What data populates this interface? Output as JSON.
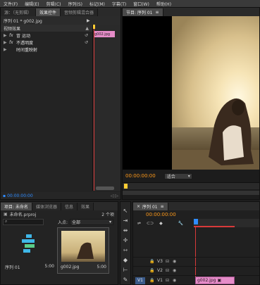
{
  "menubar": {
    "items": [
      "文件(F)",
      "编辑(E)",
      "剪辑(C)",
      "序列(S)",
      "标记(M)",
      "字幕(T)",
      "窗口(W)",
      "帮助(H)"
    ]
  },
  "source_panel": {
    "tabs": [
      "源：（无剪辑）",
      "效果控件",
      "音频剪辑混合器"
    ],
    "active_tab": 1,
    "header_title": "序列 01 * g002.jpg",
    "clip_label": "g002.jpg",
    "section_title": "视频效果",
    "effects": [
      {
        "icon": "fx",
        "label": "运动",
        "prefix": "冒"
      },
      {
        "icon": "fx",
        "label": "不透明度",
        "prefix": ""
      },
      {
        "icon": "",
        "label": "时间重映射",
        "prefix": ""
      }
    ],
    "timecode": "00:00:00:00"
  },
  "program_panel": {
    "tab": "节目: 序列 01",
    "timecode": "00:00:00:00",
    "fit_select": "适合"
  },
  "project_panel": {
    "tabs": [
      "项目: 未命名",
      "媒体浏览器",
      "信息",
      "效果"
    ],
    "project_file": "未命名.prproj",
    "item_count": "2 个项",
    "search_placeholder": "",
    "inlet_label": "入点:",
    "inlet_value": "全部",
    "items": [
      {
        "name": "序列 01",
        "duration": "5:00"
      },
      {
        "name": "g002.jpg",
        "duration": "5:00"
      }
    ]
  },
  "timeline_panel": {
    "tab": "序列 01",
    "timecode": "00:00:00:00",
    "tracks": [
      {
        "name": "V3"
      },
      {
        "name": "V2"
      },
      {
        "name": "V1",
        "source": "V1",
        "clip": "g002.jpg"
      }
    ]
  },
  "colors": {
    "timecode_blue": "#2f8cff",
    "timecode_orange": "#ff9a1a",
    "playhead_red": "#d83a3a",
    "clip_pink": "#e58cc8"
  }
}
